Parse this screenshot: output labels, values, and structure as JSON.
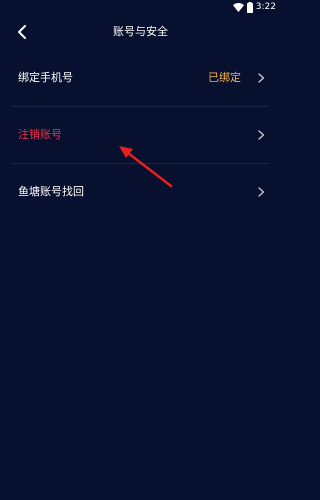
{
  "status_bar": {
    "time": "3:22",
    "icons": [
      "wifi-icon",
      "battery-icon"
    ]
  },
  "header": {
    "title": "账号与安全",
    "back_icon": "back-arrow-icon"
  },
  "menu": {
    "items": [
      {
        "label": "绑定手机号",
        "value": "已绑定",
        "icon": "chevron-right-icon"
      },
      {
        "label": "注销账号",
        "value": "",
        "icon": "chevron-right-icon"
      },
      {
        "label": "鱼塘账号找回",
        "value": "",
        "icon": "chevron-right-icon"
      }
    ]
  },
  "colors": {
    "background": "#07102e",
    "danger_text": "#e8314b",
    "value_text": "#f4b24a",
    "divider": "#1c2446",
    "annotation_arrow": "#e8201c"
  }
}
